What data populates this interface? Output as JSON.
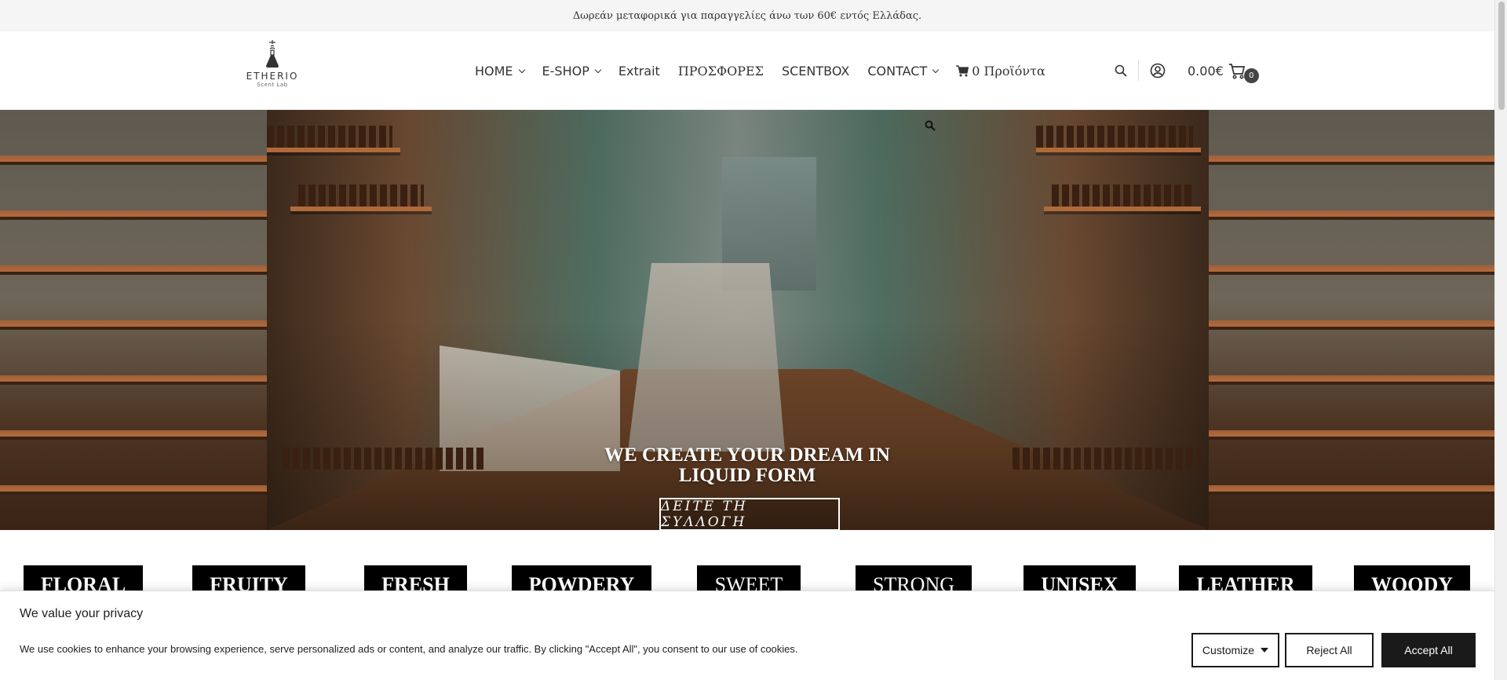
{
  "announcement": "Δωρεάν μεταφορικά για παραγγελίες άνω των 60€ εντός Ελλάδας.",
  "logo": {
    "name": "ETHERIO",
    "tagline": "Scent Lab"
  },
  "nav": {
    "home": "HOME",
    "eshop": "E-SHOP",
    "extrait": "Extrait",
    "offers": "ΠΡΟΣΦΟΡΕΣ",
    "scentbox": "SCENTBOX",
    "contact": "CONTACT",
    "cart_items": "0 Προϊόντα"
  },
  "header": {
    "cart_total": "0.00€",
    "cart_count": "0"
  },
  "hero": {
    "title": "WE CREATE YOUR DREAM IN LIQUID FORM",
    "cta": "ΔΕΙΤΕ ΤΗ ΣΥΛΛΟΓΗ"
  },
  "categories": [
    "FLORAL",
    "FRUITY",
    "FRESH",
    "POWDERY",
    "SWEET",
    "STRONG",
    "UNISEX",
    "LEATHER",
    "WOODY"
  ],
  "cookie": {
    "title": "We value your privacy",
    "text": "We use cookies to enhance your browsing experience, serve personalized ads or content, and analyze our traffic. By clicking \"Accept All\", you consent to our use of cookies.",
    "customize": "Customize",
    "reject": "Reject All",
    "accept": "Accept All"
  }
}
